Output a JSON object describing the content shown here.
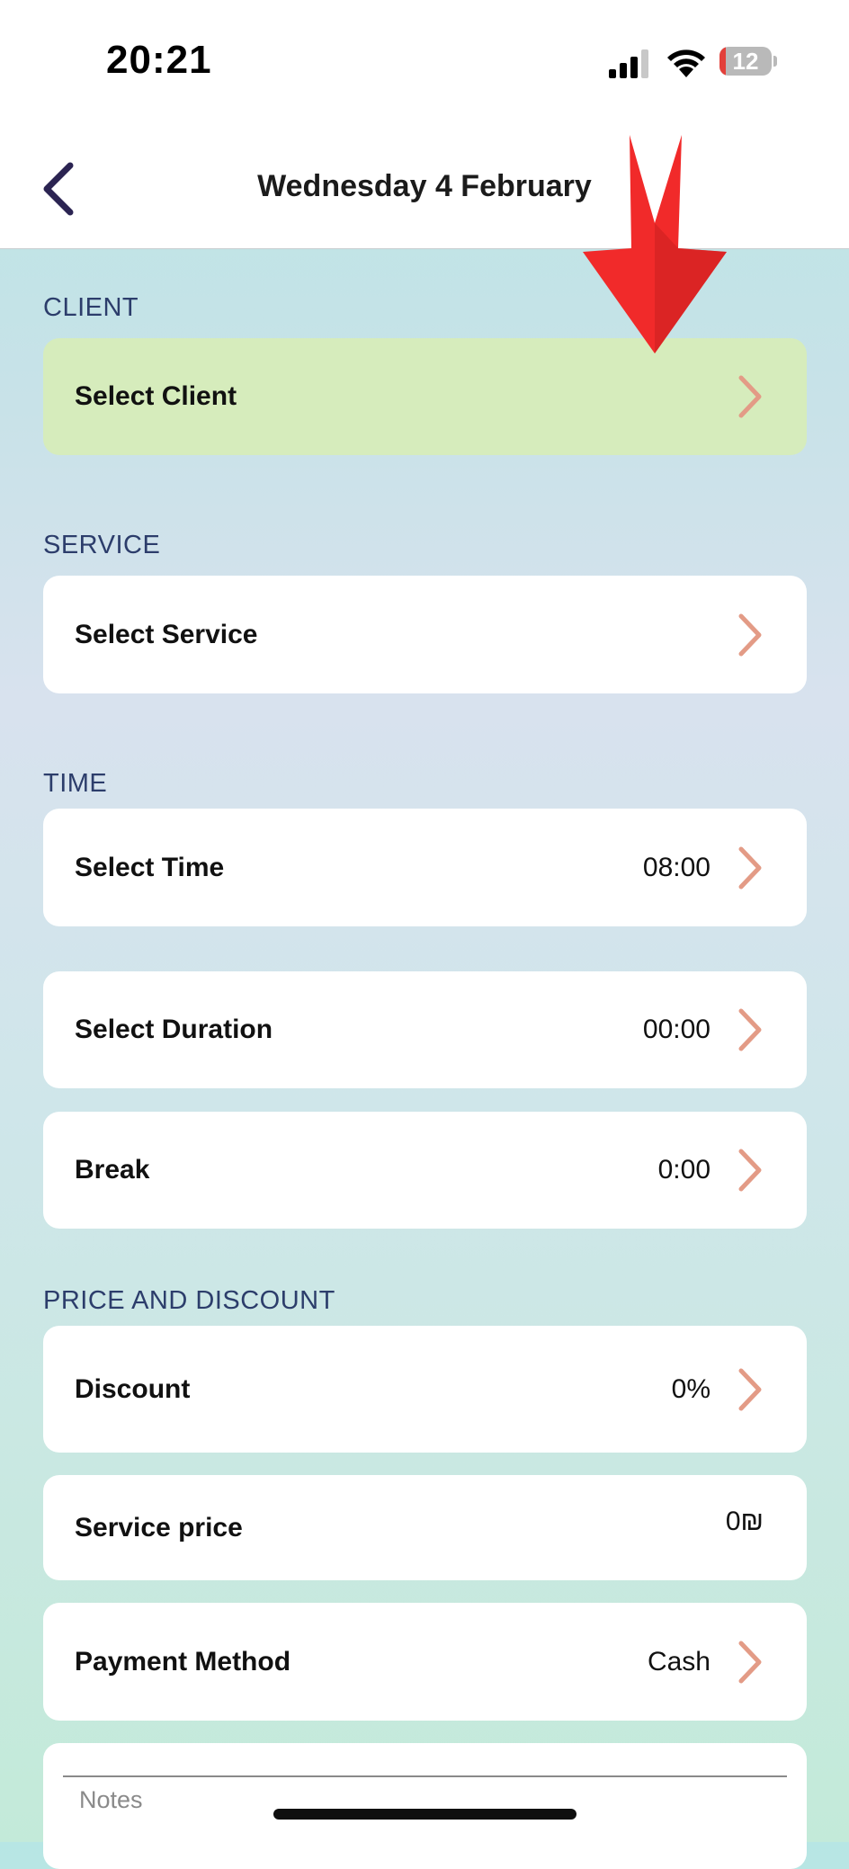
{
  "status_bar": {
    "time": "20:21",
    "battery": "12",
    "battery_level": 0.12
  },
  "nav": {
    "title": "Wednesday 4 February",
    "back_icon": "chevron-left-icon"
  },
  "sections": {
    "client": "CLIENT",
    "service": "SERVICE",
    "time": "TIME",
    "price": "PRICE AND DISCOUNT"
  },
  "rows": {
    "client": {
      "label": "Select Client"
    },
    "service": {
      "label": "Select Service"
    },
    "time": {
      "label": "Select Time",
      "value": "08:00"
    },
    "duration": {
      "label": "Select Duration",
      "value": "00:00"
    },
    "break": {
      "label": "Break",
      "value": "0:00"
    },
    "discount": {
      "label": "Discount",
      "value": "0%"
    },
    "service_price": {
      "label": "Service price",
      "value": "0₪"
    },
    "payment_method": {
      "label": "Payment Method",
      "value": "Cash"
    }
  },
  "notes": {
    "placeholder": "Notes"
  },
  "colors": {
    "accent_chevron": "#e39b86",
    "section_label": "#2c3d6b",
    "client_card": "#d6ecbc",
    "annotation_arrow": "#f12a2a"
  }
}
